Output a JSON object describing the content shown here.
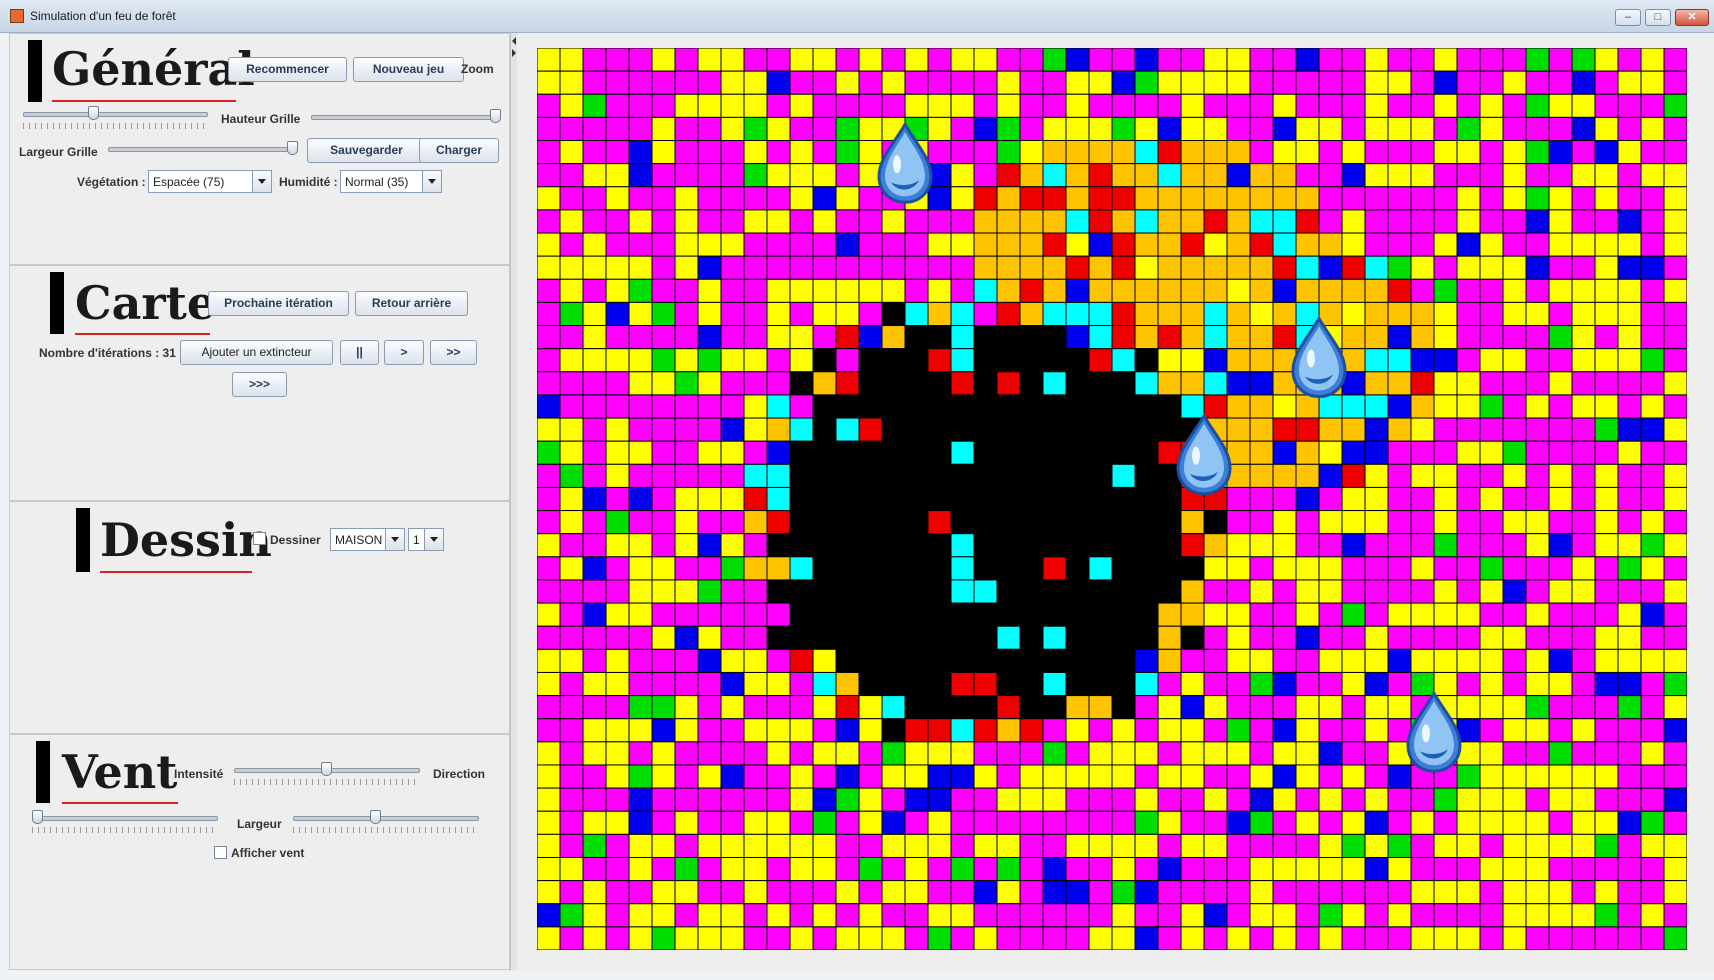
{
  "window": {
    "title": "Simulation d'un feu de forêt"
  },
  "general": {
    "title": "Général",
    "restart_label": "Recommencer",
    "new_game_label": "Nouveau jeu",
    "zoom_label": "Zoom",
    "grid_height_label": "Hauteur Grille",
    "grid_width_label": "Largeur Grille",
    "save_label": "Sauvegarder",
    "load_label": "Charger",
    "vegetation_label": "Végétation :",
    "vegetation_value": "Espacée (75)",
    "humidity_label": "Humidité :",
    "humidity_value": "Normal (35)"
  },
  "carte": {
    "title": "Carte",
    "next_label": "Prochaine itération",
    "back_label": "Retour arrière",
    "iterations_label": "Nombre d'itérations : 31",
    "add_extinguisher_label": "Ajouter un extincteur",
    "pause_label": "||",
    "play_label": ">",
    "fast_label": ">>",
    "faster_label": ">>>"
  },
  "dessin": {
    "title": "Dessin",
    "draw_label": "Dessiner",
    "type_value": "MAISON",
    "size_value": "1"
  },
  "vent": {
    "title": "Vent",
    "intensity_label": "Intensité",
    "direction_label": "Direction",
    "width_label": "Largeur",
    "show_wind_label": "Afficher vent"
  },
  "colors": {
    "pink": "#ff00ff",
    "yellow": "#ffff00",
    "green": "#00dd00",
    "blue": "#0000ee",
    "orange": "#ffc400",
    "red": "#ee0000",
    "cyan": "#00ffff",
    "black": "#000000"
  },
  "icons": {
    "water_drop": "water-drop-icon"
  }
}
